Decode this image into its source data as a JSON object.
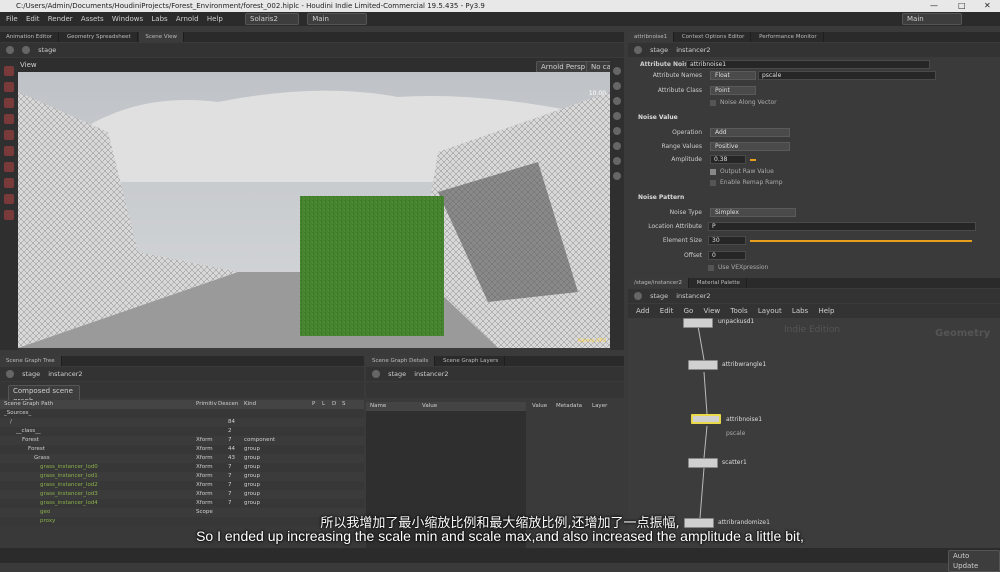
{
  "window": {
    "title": "C:/Users/Admin/Documents/HoudiniProjects/Forest_Environment/forest_002.hiplc - Houdini Indie Limited-Commercial 19.5.435 - Py3.9",
    "min": "—",
    "max": "□",
    "close": "✕"
  },
  "menu": {
    "items": [
      "File",
      "Edit",
      "Render",
      "Assets",
      "Windows",
      "Labs",
      "Arnold",
      "Help"
    ],
    "desktop": "Solaris2",
    "context": "Main",
    "right_context": "Main"
  },
  "left_tabs": [
    "Animation Editor",
    "Geometry Spreadsheet",
    "Scene View"
  ],
  "left_path": "stage",
  "viewport": {
    "label": "View",
    "camera": "Arnold Persp",
    "nocam": "No cam",
    "fps": "10.00",
    "renderer_tag": "Karma XPU"
  },
  "right_tabs": [
    "attribnoise1",
    "Context Options Editor",
    "Performance Monitor"
  ],
  "right_path": {
    "root": "stage",
    "node": "instancer2"
  },
  "params": {
    "node_type": "Attribute Noise",
    "node_name": "attribnoise1",
    "attr_names_label": "Attribute Names",
    "attr_type": "Float",
    "attr_name": "pscale",
    "attr_class_label": "Attribute Class",
    "attr_class": "Point",
    "noise_along_vector": "Noise Along Vector",
    "sec_noise_value": "Noise Value",
    "operation_label": "Operation",
    "operation": "Add",
    "range_label": "Range Values",
    "range": "Positive",
    "amplitude_label": "Amplitude",
    "amplitude": "0.38",
    "output_raw": "Output Raw Value",
    "enable_remap": "Enable Remap Ramp",
    "sec_noise_pattern": "Noise Pattern",
    "noise_type_label": "Noise Type",
    "noise_type": "Simplex",
    "location_label": "Location Attribute",
    "location": "P",
    "element_size_label": "Element Size",
    "element_size": "30",
    "offset_label": "Offset",
    "offset": "0",
    "use_vex": "Use VEXpression"
  },
  "net_tabs": [
    "/stage/instancer2",
    "Material Palette"
  ],
  "net_path": {
    "root": "stage",
    "node": "instancer2"
  },
  "net_menu": [
    "Add",
    "Edit",
    "Go",
    "View",
    "Tools",
    "Layout",
    "Labs",
    "Help"
  ],
  "net_watermark": "Indie Edition",
  "net_context": "Geometry",
  "nodes": [
    {
      "name": "unpackusd1",
      "sub": ""
    },
    {
      "name": "attribwrangle1",
      "sub": ""
    },
    {
      "name": "attribnoise1",
      "sub": "pscale"
    },
    {
      "name": "scatter1",
      "sub": ""
    },
    {
      "name": "attribrandomize1",
      "sub": ""
    }
  ],
  "sgt_tabs": [
    "Scene Graph Tree"
  ],
  "sgt_path": {
    "root": "stage",
    "node": "instancer2"
  },
  "sgt_dropdown": "Composed scene graph",
  "sgt_headers": [
    "Scene Graph Path",
    "Primitiv",
    "Descen",
    "Kind",
    "P",
    "L",
    "D",
    "S"
  ],
  "sgt_rows": [
    {
      "path": "_Sources_",
      "prim": "",
      "desc": "",
      "kind": ""
    },
    {
      "path": "/",
      "prim": "",
      "desc": "84",
      "kind": ""
    },
    {
      "path": "__class__",
      "prim": "",
      "desc": "2",
      "kind": ""
    },
    {
      "path": "Forest",
      "prim": "Xform",
      "desc": "7",
      "kind": "component"
    },
    {
      "path": "Forest",
      "prim": "Xform",
      "desc": "44",
      "kind": "group"
    },
    {
      "path": "Grass",
      "prim": "Xform",
      "desc": "43",
      "kind": "group"
    },
    {
      "path": "grass_instancer_lod0",
      "prim": "Xform",
      "desc": "7",
      "kind": "group"
    },
    {
      "path": "grass_instancer_lod1",
      "prim": "Xform",
      "desc": "7",
      "kind": "group"
    },
    {
      "path": "grass_instancer_lod2",
      "prim": "Xform",
      "desc": "7",
      "kind": "group"
    },
    {
      "path": "grass_instancer_lod3",
      "prim": "Xform",
      "desc": "7",
      "kind": "group"
    },
    {
      "path": "grass_instancer_lod4",
      "prim": "Xform",
      "desc": "7",
      "kind": "group"
    },
    {
      "path": "geo",
      "prim": "Scope",
      "desc": "",
      "kind": ""
    },
    {
      "path": "proxy",
      "prim": "",
      "desc": "",
      "kind": ""
    }
  ],
  "sgd_tabs": [
    "Scene Graph Details",
    "Scene Graph Layers"
  ],
  "sgd_path": {
    "root": "stage",
    "node": "instancer2"
  },
  "sgd_headers": [
    "Name",
    "Value"
  ],
  "sgd_side_tabs": [
    "Value",
    "Metadata",
    "Layer"
  ],
  "status": {
    "autoupdate": "Auto Update"
  },
  "subtitle": {
    "cn": "所以我增加了最小缩放比例和最大缩放比例,还增加了一点振幅,",
    "en": "So I ended up increasing the scale min and scale max,and also increased the amplitude a little bit,"
  },
  "colors": {
    "accent": "#e8a01c",
    "node_selected": "#e8d84a"
  }
}
